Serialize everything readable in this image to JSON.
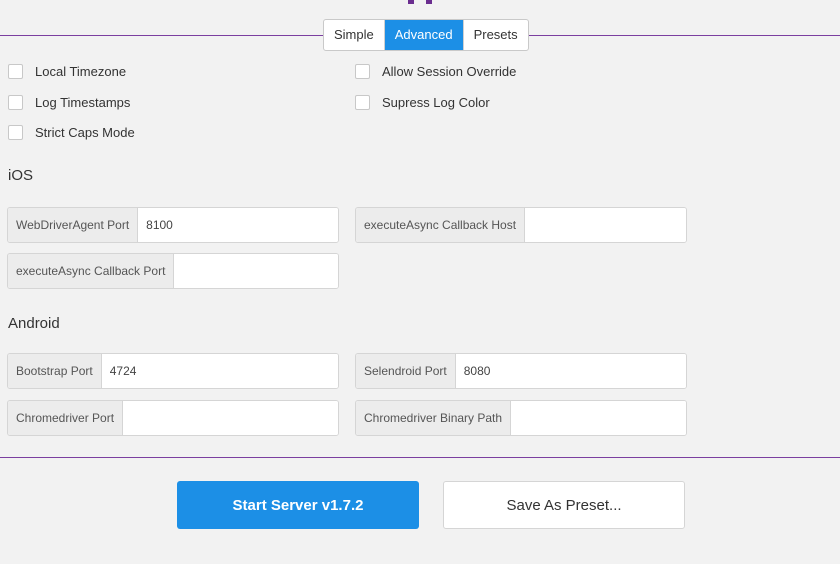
{
  "tabs": [
    {
      "label": "Simple",
      "active": false
    },
    {
      "label": "Advanced",
      "active": true
    },
    {
      "label": "Presets",
      "active": false
    }
  ],
  "general": {
    "local_timezone": {
      "label": "Local Timezone",
      "checked": false
    },
    "log_timestamps": {
      "label": "Log Timestamps",
      "checked": false
    },
    "strict_caps": {
      "label": "Strict Caps Mode",
      "checked": false
    },
    "allow_session_override": {
      "label": "Allow Session Override",
      "checked": false
    },
    "supress_log_color": {
      "label": "Supress Log Color",
      "checked": false
    }
  },
  "ios": {
    "title": "iOS",
    "wda_port": {
      "label": "WebDriverAgent Port",
      "value": "8100"
    },
    "callback_host": {
      "label": "executeAsync Callback Host",
      "value": ""
    },
    "callback_port": {
      "label": "executeAsync Callback Port",
      "value": ""
    }
  },
  "android": {
    "title": "Android",
    "bootstrap_port": {
      "label": "Bootstrap Port",
      "value": "4724"
    },
    "selendroid_port": {
      "label": "Selendroid Port",
      "value": "8080"
    },
    "chromedriver_port": {
      "label": "Chromedriver Port",
      "value": ""
    },
    "chromedriver_binary": {
      "label": "Chromedriver Binary Path",
      "value": ""
    }
  },
  "actions": {
    "start_server": "Start Server v1.7.2",
    "save_preset": "Save As Preset..."
  },
  "colors": {
    "accent": "#1c8fe6",
    "divider": "#7b3fa0"
  }
}
